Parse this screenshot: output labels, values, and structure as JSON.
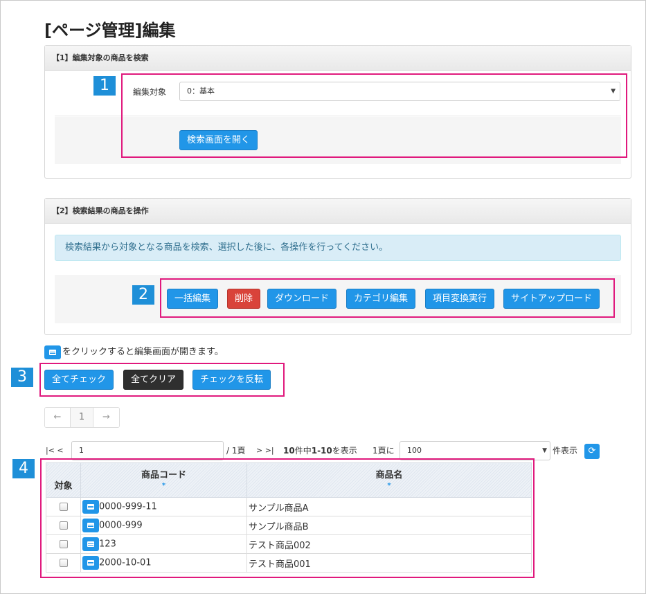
{
  "page_title": "[ページ管理]編集",
  "section1": {
    "heading": "【1】編集対象の商品を検索",
    "target_label": "編集対象",
    "target_value": "0：基本",
    "open_search_button": "検索画面を開く"
  },
  "section2": {
    "heading": "【2】検索結果の商品を操作",
    "info": "検索結果から対象となる商品を検索、選択した後に、各操作を行ってください。",
    "buttons": [
      "一括編集",
      "削除",
      "ダウンロード",
      "カテゴリ編集",
      "項目変換実行",
      "サイトアップロード"
    ]
  },
  "hint_text": "をクリックすると編集画面が開きます。",
  "check_buttons": [
    "全てチェック",
    "全てクリア",
    "チェックを反転"
  ],
  "pager": {
    "prev": "←",
    "page": "1",
    "next": "→"
  },
  "nav": {
    "first": "|< <",
    "page_input": "1",
    "total_pages": "/ 1頁",
    "last": "> >|",
    "summary_bold": "10",
    "summary_mid": "件中",
    "summary_range": "1-10",
    "summary_tail": "を表示",
    "per_page_prefix": "1頁に",
    "per_page_value": "100",
    "per_page_suffix": "件表示"
  },
  "table": {
    "headers": {
      "check": "対象",
      "code": "商品コード",
      "name": "商品名",
      "sort_mark": "*"
    },
    "rows": [
      {
        "code": "0000-999-11",
        "name": "サンプル商品A"
      },
      {
        "code": "0000-999",
        "name": "サンプル商品B"
      },
      {
        "code": "123",
        "name": "テスト商品002"
      },
      {
        "code": "2000-10-01",
        "name": "テスト商品001"
      }
    ]
  },
  "callouts": [
    "1",
    "2",
    "3",
    "4"
  ],
  "colors": {
    "primary": "#2196e8",
    "danger": "#d9433a",
    "dark": "#2f2f2f",
    "highlight": "#e0197d",
    "callout": "#1e8fd8"
  },
  "icons": [
    "edit-icon",
    "refresh-icon",
    "select-arrow-icon"
  ]
}
